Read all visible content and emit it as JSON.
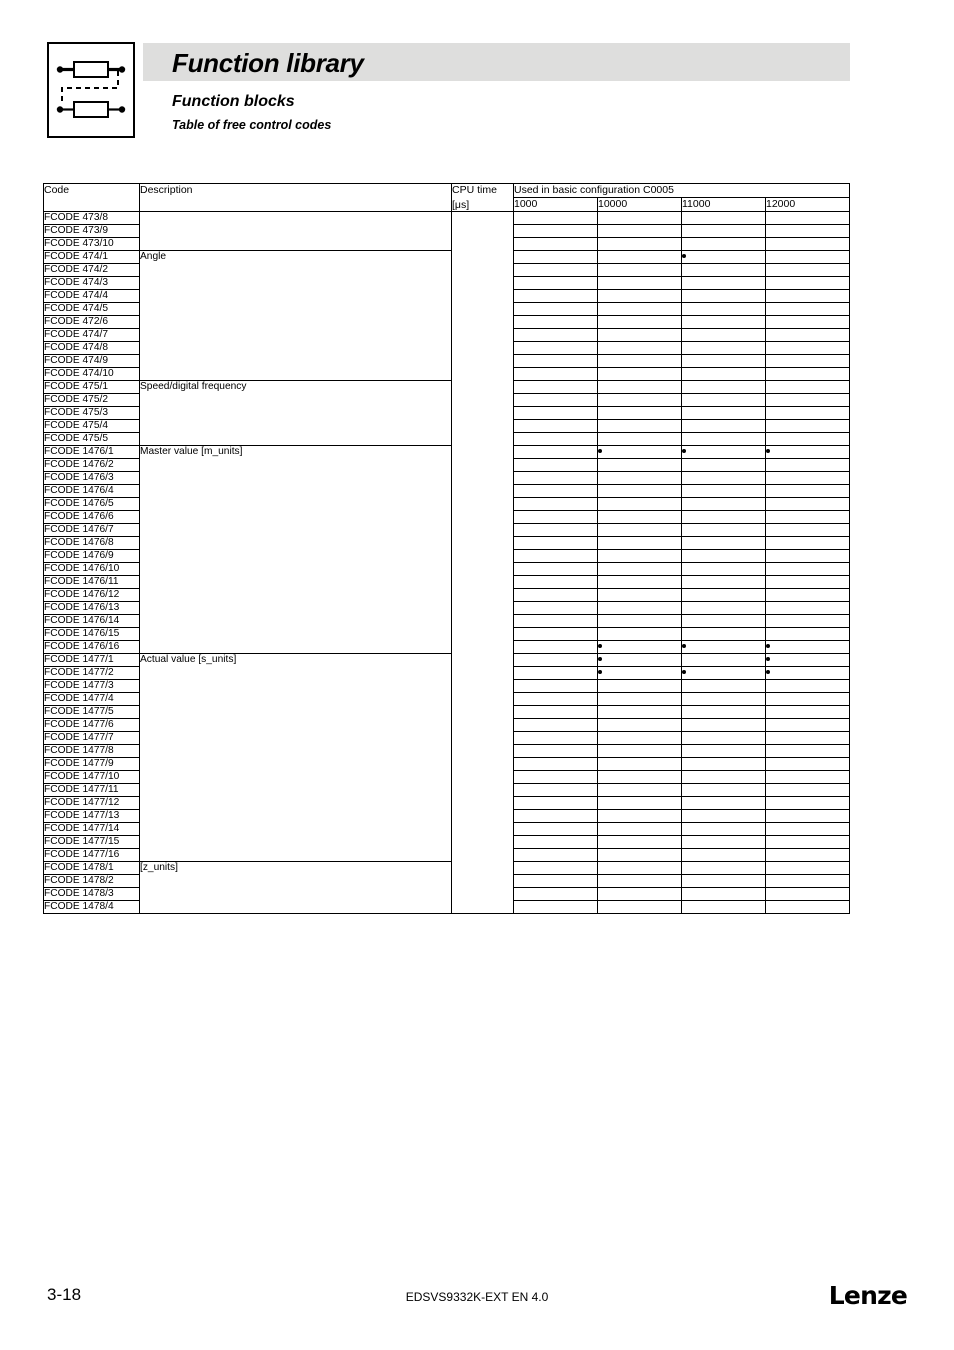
{
  "header": {
    "title": "Function library",
    "subtitle": "Function blocks",
    "subtitle2": "Table of free control codes",
    "icon_name": "function-block-diagram-icon"
  },
  "table": {
    "columns": {
      "code": "Code",
      "description": "Description",
      "cpu_time": "CPU time",
      "cpu_time_unit": "[μs]",
      "config_group": "Used in basic configuration C0005",
      "config_values": [
        "1000",
        "10000",
        "11000",
        "12000"
      ]
    },
    "cpu_time_value": "",
    "groups": [
      {
        "description": "",
        "rows": [
          {
            "code": "FCODE 473/8",
            "marks": [
              false,
              false,
              false,
              false
            ]
          },
          {
            "code": "FCODE 473/9",
            "marks": [
              false,
              false,
              false,
              false
            ]
          },
          {
            "code": "FCODE 473/10",
            "marks": [
              false,
              false,
              false,
              false
            ]
          }
        ]
      },
      {
        "description": "Angle",
        "rows": [
          {
            "code": "FCODE 474/1",
            "marks": [
              false,
              false,
              true,
              false
            ]
          },
          {
            "code": "FCODE 474/2",
            "marks": [
              false,
              false,
              false,
              false
            ]
          },
          {
            "code": "FCODE 474/3",
            "marks": [
              false,
              false,
              false,
              false
            ]
          },
          {
            "code": "FCODE 474/4",
            "marks": [
              false,
              false,
              false,
              false
            ]
          },
          {
            "code": "FCODE 474/5",
            "marks": [
              false,
              false,
              false,
              false
            ]
          },
          {
            "code": "FCODE 472/6",
            "marks": [
              false,
              false,
              false,
              false
            ]
          },
          {
            "code": "FCODE 474/7",
            "marks": [
              false,
              false,
              false,
              false
            ]
          },
          {
            "code": "FCODE 474/8",
            "marks": [
              false,
              false,
              false,
              false
            ]
          },
          {
            "code": "FCODE 474/9",
            "marks": [
              false,
              false,
              false,
              false
            ]
          },
          {
            "code": "FCODE 474/10",
            "marks": [
              false,
              false,
              false,
              false
            ]
          }
        ]
      },
      {
        "description": "Speed/digital frequency",
        "rows": [
          {
            "code": "FCODE 475/1",
            "marks": [
              false,
              false,
              false,
              false
            ]
          },
          {
            "code": "FCODE 475/2",
            "marks": [
              false,
              false,
              false,
              false
            ]
          },
          {
            "code": "FCODE 475/3",
            "marks": [
              false,
              false,
              false,
              false
            ]
          },
          {
            "code": "FCODE 475/4",
            "marks": [
              false,
              false,
              false,
              false
            ]
          },
          {
            "code": "FCODE 475/5",
            "marks": [
              false,
              false,
              false,
              false
            ]
          }
        ]
      },
      {
        "description": "Master value [m_units]",
        "rows": [
          {
            "code": "FCODE 1476/1",
            "marks": [
              false,
              true,
              true,
              true
            ]
          },
          {
            "code": "FCODE 1476/2",
            "marks": [
              false,
              false,
              false,
              false
            ]
          },
          {
            "code": "FCODE 1476/3",
            "marks": [
              false,
              false,
              false,
              false
            ]
          },
          {
            "code": "FCODE 1476/4",
            "marks": [
              false,
              false,
              false,
              false
            ]
          },
          {
            "code": "FCODE 1476/5",
            "marks": [
              false,
              false,
              false,
              false
            ]
          },
          {
            "code": "FCODE 1476/6",
            "marks": [
              false,
              false,
              false,
              false
            ]
          },
          {
            "code": "FCODE 1476/7",
            "marks": [
              false,
              false,
              false,
              false
            ]
          },
          {
            "code": "FCODE 1476/8",
            "marks": [
              false,
              false,
              false,
              false
            ]
          },
          {
            "code": "FCODE 1476/9",
            "marks": [
              false,
              false,
              false,
              false
            ]
          },
          {
            "code": "FCODE 1476/10",
            "marks": [
              false,
              false,
              false,
              false
            ]
          },
          {
            "code": "FCODE 1476/11",
            "marks": [
              false,
              false,
              false,
              false
            ]
          },
          {
            "code": "FCODE 1476/12",
            "marks": [
              false,
              false,
              false,
              false
            ]
          },
          {
            "code": "FCODE 1476/13",
            "marks": [
              false,
              false,
              false,
              false
            ]
          },
          {
            "code": "FCODE 1476/14",
            "marks": [
              false,
              false,
              false,
              false
            ]
          },
          {
            "code": "FCODE 1476/15",
            "marks": [
              false,
              false,
              false,
              false
            ]
          },
          {
            "code": "FCODE 1476/16",
            "marks": [
              false,
              true,
              true,
              true
            ]
          }
        ]
      },
      {
        "description": "Actual value [s_units]",
        "rows": [
          {
            "code": "FCODE 1477/1",
            "marks": [
              false,
              true,
              false,
              true
            ]
          },
          {
            "code": "FCODE 1477/2",
            "marks": [
              false,
              true,
              true,
              true
            ]
          },
          {
            "code": "FCODE 1477/3",
            "marks": [
              false,
              false,
              false,
              false
            ]
          },
          {
            "code": "FCODE 1477/4",
            "marks": [
              false,
              false,
              false,
              false
            ]
          },
          {
            "code": "FCODE 1477/5",
            "marks": [
              false,
              false,
              false,
              false
            ]
          },
          {
            "code": "FCODE 1477/6",
            "marks": [
              false,
              false,
              false,
              false
            ]
          },
          {
            "code": "FCODE 1477/7",
            "marks": [
              false,
              false,
              false,
              false
            ]
          },
          {
            "code": "FCODE 1477/8",
            "marks": [
              false,
              false,
              false,
              false
            ]
          },
          {
            "code": "FCODE 1477/9",
            "marks": [
              false,
              false,
              false,
              false
            ]
          },
          {
            "code": "FCODE 1477/10",
            "marks": [
              false,
              false,
              false,
              false
            ]
          },
          {
            "code": "FCODE 1477/11",
            "marks": [
              false,
              false,
              false,
              false
            ]
          },
          {
            "code": "FCODE 1477/12",
            "marks": [
              false,
              false,
              false,
              false
            ]
          },
          {
            "code": "FCODE 1477/13",
            "marks": [
              false,
              false,
              false,
              false
            ]
          },
          {
            "code": "FCODE 1477/14",
            "marks": [
              false,
              false,
              false,
              false
            ]
          },
          {
            "code": "FCODE 1477/15",
            "marks": [
              false,
              false,
              false,
              false
            ]
          },
          {
            "code": "FCODE 1477/16",
            "marks": [
              false,
              false,
              false,
              false
            ]
          }
        ]
      },
      {
        "description": "[z_units]",
        "rows": [
          {
            "code": "FCODE 1478/1",
            "marks": [
              false,
              false,
              false,
              false
            ]
          },
          {
            "code": "FCODE 1478/2",
            "marks": [
              false,
              false,
              false,
              false
            ]
          },
          {
            "code": "FCODE 1478/3",
            "marks": [
              false,
              false,
              false,
              false
            ]
          },
          {
            "code": "FCODE 1478/4",
            "marks": [
              false,
              false,
              false,
              false
            ]
          }
        ]
      }
    ]
  },
  "footer": {
    "page_number": "3-18",
    "document_id": "EDSVS9332K-EXT EN 4.0",
    "brand": "Lenze"
  }
}
